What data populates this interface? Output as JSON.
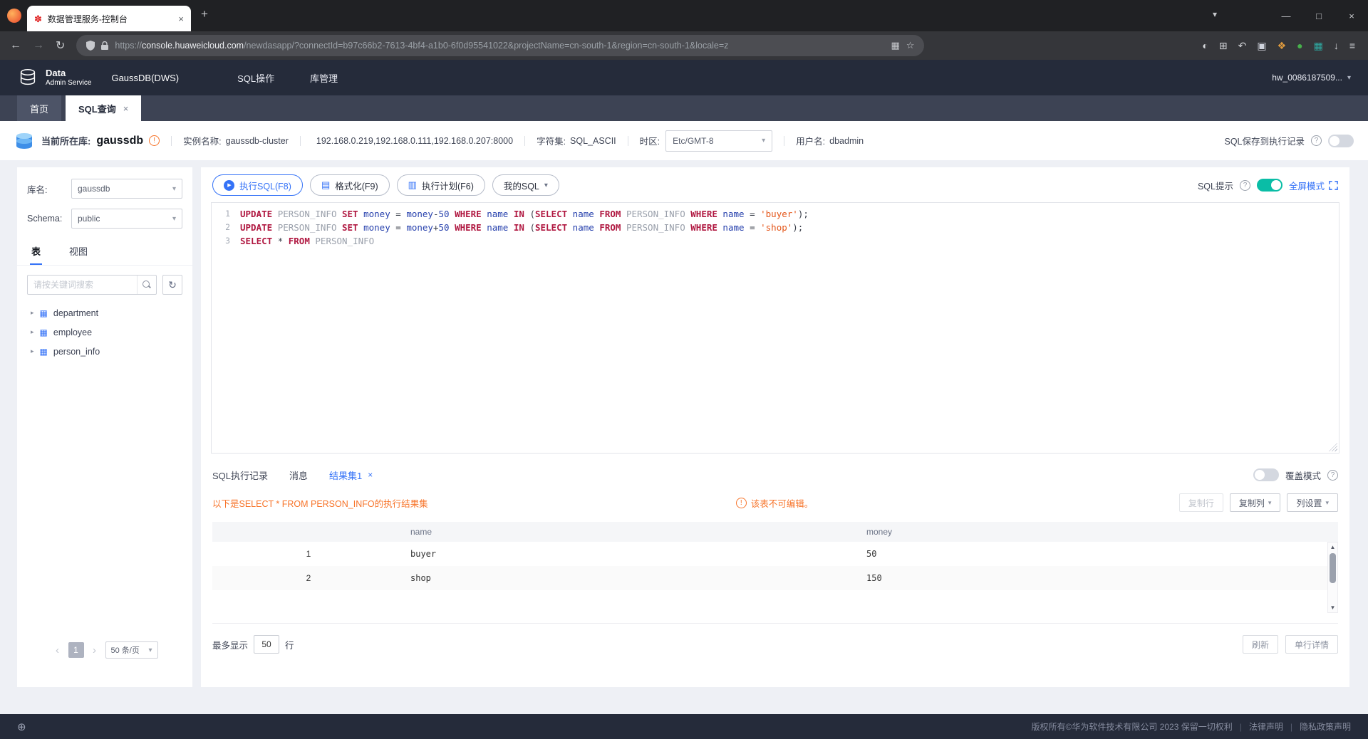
{
  "icons": {
    "huawei-logo": "✽",
    "new-tab": "+",
    "tab-caret": "▾",
    "minimize": "—",
    "maximize": "□",
    "close": "×",
    "back": "←",
    "forward": "→",
    "reload": "↻",
    "qr": "▦",
    "star": "☆",
    "caret-down": "▾",
    "caret-right": "▸",
    "tree-table": "▦",
    "refresh": "↻",
    "prev": "‹",
    "next": "›",
    "play": "▶",
    "format-doc": "▤",
    "exec-plan": "▥",
    "globe": "⊕",
    "warn": "!",
    "help": "?",
    "info": "!",
    "up": "▲",
    "down": "▼"
  },
  "browser": {
    "tab_title": "数据管理服务-控制台",
    "url_scheme": "https://",
    "url_domain": "console.huaweicloud.com",
    "url_path": "/newdasapp/?connectId=b97c66b2-7613-4bf4-a1b0-6f0d95541022&projectName=cn-south-1&region=cn-south-1&locale=z",
    "right_icons": [
      {
        "name": "badge-icon",
        "glyph": "◐",
        "color": "#d3d5d9"
      },
      {
        "name": "screenshot-icon",
        "glyph": "⊞",
        "color": "#d3d5d9"
      },
      {
        "name": "history-undo-icon",
        "glyph": "↶",
        "color": "#d3d5d9"
      },
      {
        "name": "notes-extension-icon",
        "glyph": "▣",
        "color": "#cfd3dc"
      },
      {
        "name": "colorful-extension-icon",
        "glyph": "❖",
        "color": "#e09b3d"
      },
      {
        "name": "green-extension-icon",
        "glyph": "●",
        "color": "#47b04b"
      },
      {
        "name": "teal-extension-icon",
        "glyph": "▦",
        "color": "#2fa8a0"
      },
      {
        "name": "downloads-icon",
        "glyph": "↓",
        "color": "#d3d5d9"
      },
      {
        "name": "browser-menu-icon",
        "glyph": "≡",
        "color": "#d3d5d9"
      }
    ]
  },
  "header": {
    "logo_line1": "Data",
    "logo_line2": "Admin Service",
    "product": "GaussDB(DWS)",
    "menu": [
      {
        "label": "SQL操作"
      },
      {
        "label": "库管理"
      }
    ],
    "account": "hw_0086187509..."
  },
  "console_tabs": {
    "home": "首页",
    "sql": "SQL查询"
  },
  "infobar": {
    "current_db_label": "当前所在库:",
    "current_db": "gaussdb",
    "instance_label": "实例名称:",
    "instance": "gaussdb-cluster",
    "hosts": "192.168.0.219,192.168.0.111,192.168.0.207:8000",
    "charset_label": "字符集:",
    "charset": "SQL_ASCII",
    "timezone_label": "时区:",
    "timezone": "Etc/GMT-8",
    "user_label": "用户名:",
    "user": "dbadmin",
    "save_record_label": "SQL保存到执行记录"
  },
  "sidebar": {
    "db_label": "库名:",
    "db_value": "gaussdb",
    "schema_label": "Schema:",
    "schema_value": "public",
    "tab_table": "表",
    "tab_view": "视图",
    "search_placeholder": "请按关键词搜索",
    "tables": [
      {
        "name": "department"
      },
      {
        "name": "employee"
      },
      {
        "name": "person_info"
      }
    ],
    "page": "1",
    "page_size": "50 条/页"
  },
  "editor_toolbar": {
    "run": "执行SQL(F8)",
    "format": "格式化(F9)",
    "plan": "执行计划(F6)",
    "my_sql": "我的SQL",
    "sql_tip_label": "SQL提示",
    "fullscreen_label": "全屏模式"
  },
  "editor": {
    "lines": [
      [
        {
          "t": "k",
          "s": "UPDATE "
        },
        {
          "t": "t",
          "s": "PERSON_INFO "
        },
        {
          "t": "k",
          "s": "SET "
        },
        {
          "t": "c",
          "s": "money "
        },
        {
          "t": "o",
          "s": "= "
        },
        {
          "t": "c",
          "s": "money"
        },
        {
          "t": "o",
          "s": "-"
        },
        {
          "t": "n",
          "s": "50 "
        },
        {
          "t": "k",
          "s": "WHERE "
        },
        {
          "t": "c",
          "s": "name "
        },
        {
          "t": "k",
          "s": "IN "
        },
        {
          "t": "o",
          "s": "("
        },
        {
          "t": "k",
          "s": "SELECT "
        },
        {
          "t": "c",
          "s": "name "
        },
        {
          "t": "k",
          "s": "FROM "
        },
        {
          "t": "t",
          "s": "PERSON_INFO "
        },
        {
          "t": "k",
          "s": "WHERE "
        },
        {
          "t": "c",
          "s": "name "
        },
        {
          "t": "o",
          "s": "= "
        },
        {
          "t": "s",
          "s": "'buyer'"
        },
        {
          "t": "o",
          "s": ");"
        }
      ],
      [
        {
          "t": "k",
          "s": "UPDATE "
        },
        {
          "t": "t",
          "s": "PERSON_INFO "
        },
        {
          "t": "k",
          "s": "SET "
        },
        {
          "t": "c",
          "s": "money "
        },
        {
          "t": "o",
          "s": "= "
        },
        {
          "t": "c",
          "s": "money"
        },
        {
          "t": "o",
          "s": "+"
        },
        {
          "t": "n",
          "s": "50 "
        },
        {
          "t": "k",
          "s": "WHERE "
        },
        {
          "t": "c",
          "s": "name "
        },
        {
          "t": "k",
          "s": "IN "
        },
        {
          "t": "o",
          "s": "("
        },
        {
          "t": "k",
          "s": "SELECT "
        },
        {
          "t": "c",
          "s": "name "
        },
        {
          "t": "k",
          "s": "FROM "
        },
        {
          "t": "t",
          "s": "PERSON_INFO "
        },
        {
          "t": "k",
          "s": "WHERE "
        },
        {
          "t": "c",
          "s": "name "
        },
        {
          "t": "o",
          "s": "= "
        },
        {
          "t": "s",
          "s": "'shop'"
        },
        {
          "t": "o",
          "s": ");"
        }
      ],
      [
        {
          "t": "k",
          "s": "SELECT "
        },
        {
          "t": "o",
          "s": "* "
        },
        {
          "t": "k",
          "s": "FROM "
        },
        {
          "t": "t",
          "s": "PERSON_INFO"
        }
      ]
    ]
  },
  "results": {
    "tabs": [
      {
        "label": "SQL执行记录"
      },
      {
        "label": "消息"
      },
      {
        "label": "结果集1",
        "active": true,
        "closable": true
      }
    ],
    "overwrite_label": "覆盖模式",
    "message": "以下是SELECT * FROM PERSON_INFO的执行结果集",
    "not_editable": "该表不可编辑。",
    "copy_row": "复制行",
    "copy_column": "复制列",
    "column_settings": "列设置",
    "table": {
      "columns": [
        "",
        "name",
        "money"
      ],
      "rows": [
        [
          "1",
          "buyer",
          "50"
        ],
        [
          "2",
          "shop",
          "150"
        ]
      ]
    },
    "max_label": "最多显示",
    "max_value": "50",
    "rows_unit": "行",
    "refresh": "刷新",
    "row_detail": "单行详情"
  },
  "footer": {
    "copyright": "版权所有©华为软件技术有限公司 2023 保留一切权利",
    "links": [
      {
        "label": "法律声明"
      },
      {
        "label": "隐私政策声明"
      }
    ]
  },
  "colors": {
    "accent": "#3472f7",
    "toggle_on": "#0abda6",
    "orange": "#f7742a",
    "header_bg": "#252b3a"
  }
}
